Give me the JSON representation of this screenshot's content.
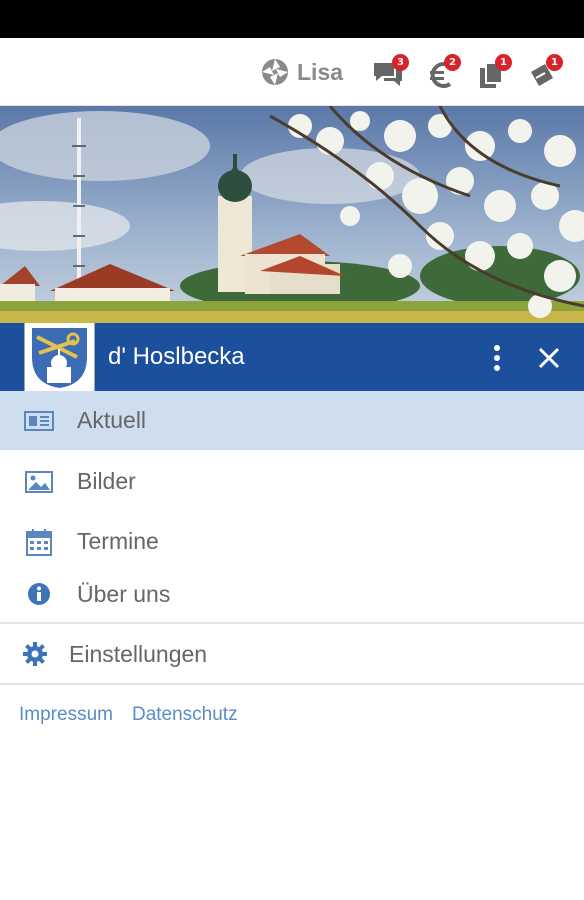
{
  "topbar": {
    "user_name": "Lisa",
    "icons": [
      {
        "name": "messages-icon",
        "badge": "3"
      },
      {
        "name": "euro-icon",
        "badge": "2"
      },
      {
        "name": "documents-icon",
        "badge": "1"
      },
      {
        "name": "tickets-icon",
        "badge": "1"
      }
    ]
  },
  "header": {
    "title": "d' Hoslbecka"
  },
  "menu": {
    "items": [
      {
        "label": "Aktuell",
        "icon": "newspaper-icon",
        "active": true
      },
      {
        "label": "Bilder",
        "icon": "image-icon",
        "active": false
      },
      {
        "label": "Termine",
        "icon": "calendar-icon",
        "active": false
      },
      {
        "label": "Über uns",
        "icon": "info-icon",
        "active": false
      }
    ],
    "settings_label": "Einstellungen"
  },
  "footer": {
    "impressum": "Impressum",
    "datenschutz": "Datenschutz"
  },
  "colors": {
    "header_blue": "#1c4f9c",
    "active_bg": "#cfdeee",
    "badge_red": "#d8232a",
    "link_blue": "#5a8cc6"
  }
}
